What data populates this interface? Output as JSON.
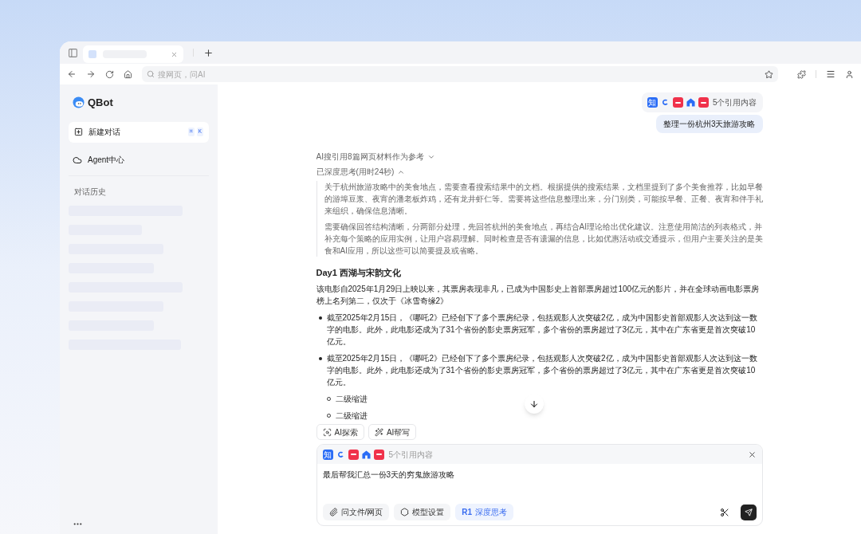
{
  "browser": {
    "address_placeholder": "搜网页，问AI"
  },
  "sidebar": {
    "logo": "QBot",
    "new_chat": {
      "label": "新建对话",
      "keys": [
        "⌘",
        "K"
      ]
    },
    "agent": "Agent中心",
    "history_title": "对话历史"
  },
  "user_message": {
    "sources": [
      {
        "kind": "text",
        "label": "知",
        "color": "#2b6df6"
      },
      {
        "kind": "swirl",
        "color": "#2b6df6"
      },
      {
        "kind": "badge",
        "color": "#f0324b"
      },
      {
        "kind": "building",
        "color": "#2b6df6"
      },
      {
        "kind": "badge",
        "color": "#f0324b"
      }
    ],
    "source_count": "5个引用内容",
    "text": "整理一份杭州3天旅游攻略"
  },
  "answer": {
    "references": {
      "label": "AI搜引用8篇网页材料作为参考",
      "expanded": false
    },
    "thinking": {
      "label": "已深度思考(用时24秒)",
      "expanded": true,
      "paragraphs": [
        "关于杭州旅游攻略中的美食地点，需要查看搜索结果中的文档。根据提供的搜索结果，文档里提到了多个美食推荐，比如早餐的游埠豆浆、夜宵的潘老板炸鸡，还有龙井虾仁等。需要将这些信息整理出来，分门别类，可能按早餐、正餐、夜宵和伴手礼来组织，确保信息清晰。",
        "需要确保回答结构清晰，分两部分处理，先回答杭州的美食地点，再结合AI理论给出优化建议。注意使用简洁的列表格式，并补充每个策略的应用实例，让用户容易理解。同时检查是否有遗漏的信息，比如优惠活动或交通提示，但用户主要关注的是美食和AI应用，所以这些可以简要提及或省略。"
      ]
    },
    "heading": "Day1 西湖与宋韵文化",
    "intro": "该电影自2025年1月29日上映以来，其票房表现非凡，已成为中国影史上首部票房超过100亿元的影片，并在全球动画电影票房榜上名列第二，仅次于《冰雪奇缘2》",
    "bullets": [
      {
        "text": "截至2025年2月15日，《哪吒2》已经创下了多个票房纪录，包括观影人次突破2亿，成为中国影史首部观影人次达到这一数字的电影。此外，此电影还成为了31个省份的影史票房冠军，多个省份的票房超过了3亿元，其中在广东省更是首次突破10亿元。"
      },
      {
        "text": "截至2025年2月15日，《哪吒2》已经创下了多个票房纪录，包括观影人次突破2亿，成为中国影史首部观影人次达到这一数字的电影。此外，此电影还成为了31个省份的影史票房冠军，多个省份的票房超过了3亿元，其中在广东省更是首次突破10亿元。",
        "children": [
          {
            "text": "二级缩进"
          },
          {
            "text": "二级缩进"
          }
        ]
      }
    ]
  },
  "tools": [
    {
      "kind": "explore",
      "label": "AI探索"
    },
    {
      "kind": "write",
      "label": "AI帮写"
    }
  ],
  "composer": {
    "sources": [
      {
        "kind": "text",
        "label": "知",
        "color": "#2b6df6"
      },
      {
        "kind": "swirl",
        "color": "#2b6df6"
      },
      {
        "kind": "badge",
        "color": "#f0324b"
      },
      {
        "kind": "building",
        "color": "#2b6df6"
      },
      {
        "kind": "badge",
        "color": "#f0324b"
      }
    ],
    "source_count": "5个引用内容",
    "value": "最后帮我汇总一份3天的穷鬼旅游攻略",
    "options": [
      {
        "kind": "file",
        "label": "问文件/网页",
        "selected": false
      },
      {
        "kind": "model",
        "label": "模型设置",
        "selected": false
      },
      {
        "kind": "r1",
        "badge": "R1",
        "label": "深度思考",
        "selected": true
      }
    ]
  }
}
